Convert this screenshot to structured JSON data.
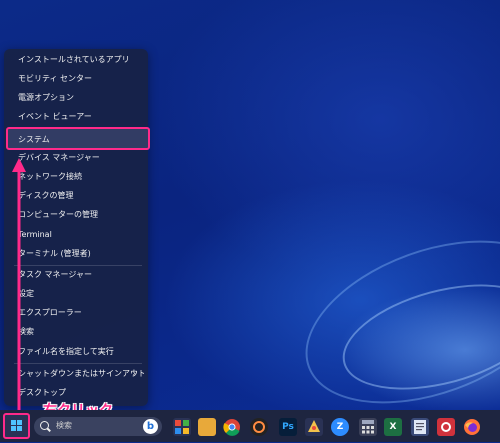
{
  "start_menu": {
    "items": [
      {
        "label": "インストールされているアプリ"
      },
      {
        "label": "モビリティ センター"
      },
      {
        "label": "電源オプション"
      },
      {
        "label": "イベント ビューアー"
      },
      {
        "label": "システム"
      },
      {
        "label": "デバイス マネージャー"
      },
      {
        "label": "ネットワーク接続"
      },
      {
        "label": "ディスクの管理"
      },
      {
        "label": "コンピューターの管理"
      },
      {
        "label": "Terminal"
      },
      {
        "label": "ターミナル (管理者)"
      },
      {
        "label": "タスク マネージャー"
      },
      {
        "label": "設定"
      },
      {
        "label": "エクスプローラー"
      },
      {
        "label": "検索"
      },
      {
        "label": "ファイル名を指定して実行"
      },
      {
        "label": "シャットダウンまたはサインアウト",
        "chevron": "›"
      },
      {
        "label": "デスクトップ"
      }
    ]
  },
  "annotation": {
    "callout": "右クリック",
    "highlight_color": "#ff2a8a"
  },
  "taskbar": {
    "search_placeholder": "検索",
    "icons": [
      "widgets-icon",
      "file-explorer-icon",
      "chrome-icon",
      "app-icon",
      "photoshop-icon",
      "paint-icon",
      "zoom-icon",
      "calculator-icon",
      "excel-icon",
      "notepad-icon",
      "app-icon",
      "firefox-icon"
    ]
  }
}
